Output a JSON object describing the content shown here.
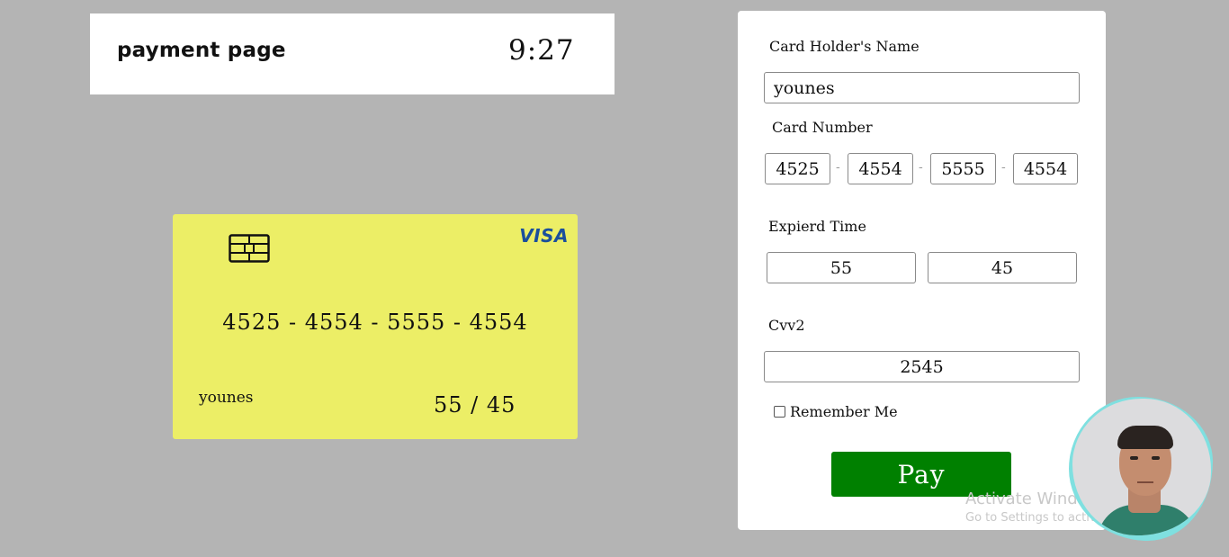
{
  "header": {
    "title": "payment page",
    "time": "9:27"
  },
  "card": {
    "brand": "VISA",
    "number_display": "4525 - 4554 - 5555 - 4554",
    "holder": "younes",
    "expiry_display": "55 / 45",
    "background_color": "#ecee66"
  },
  "form": {
    "name_label": "Card Holder's Name",
    "name_value": "younes",
    "number_label": "Card Number",
    "number_parts": [
      "4525",
      "4554",
      "5555",
      "4554"
    ],
    "separator": "-",
    "expiry_label": "Expierd Time",
    "expiry_month": "55",
    "expiry_year": "45",
    "cvv_label": "Cvv2",
    "cvv_value": "2545",
    "remember_label": "Remember Me",
    "remember_checked": false,
    "pay_label": "Pay",
    "pay_color": "#008000"
  },
  "watermark": {
    "line1": "Activate Windows",
    "line2": "Go to Settings to activate Windows."
  }
}
